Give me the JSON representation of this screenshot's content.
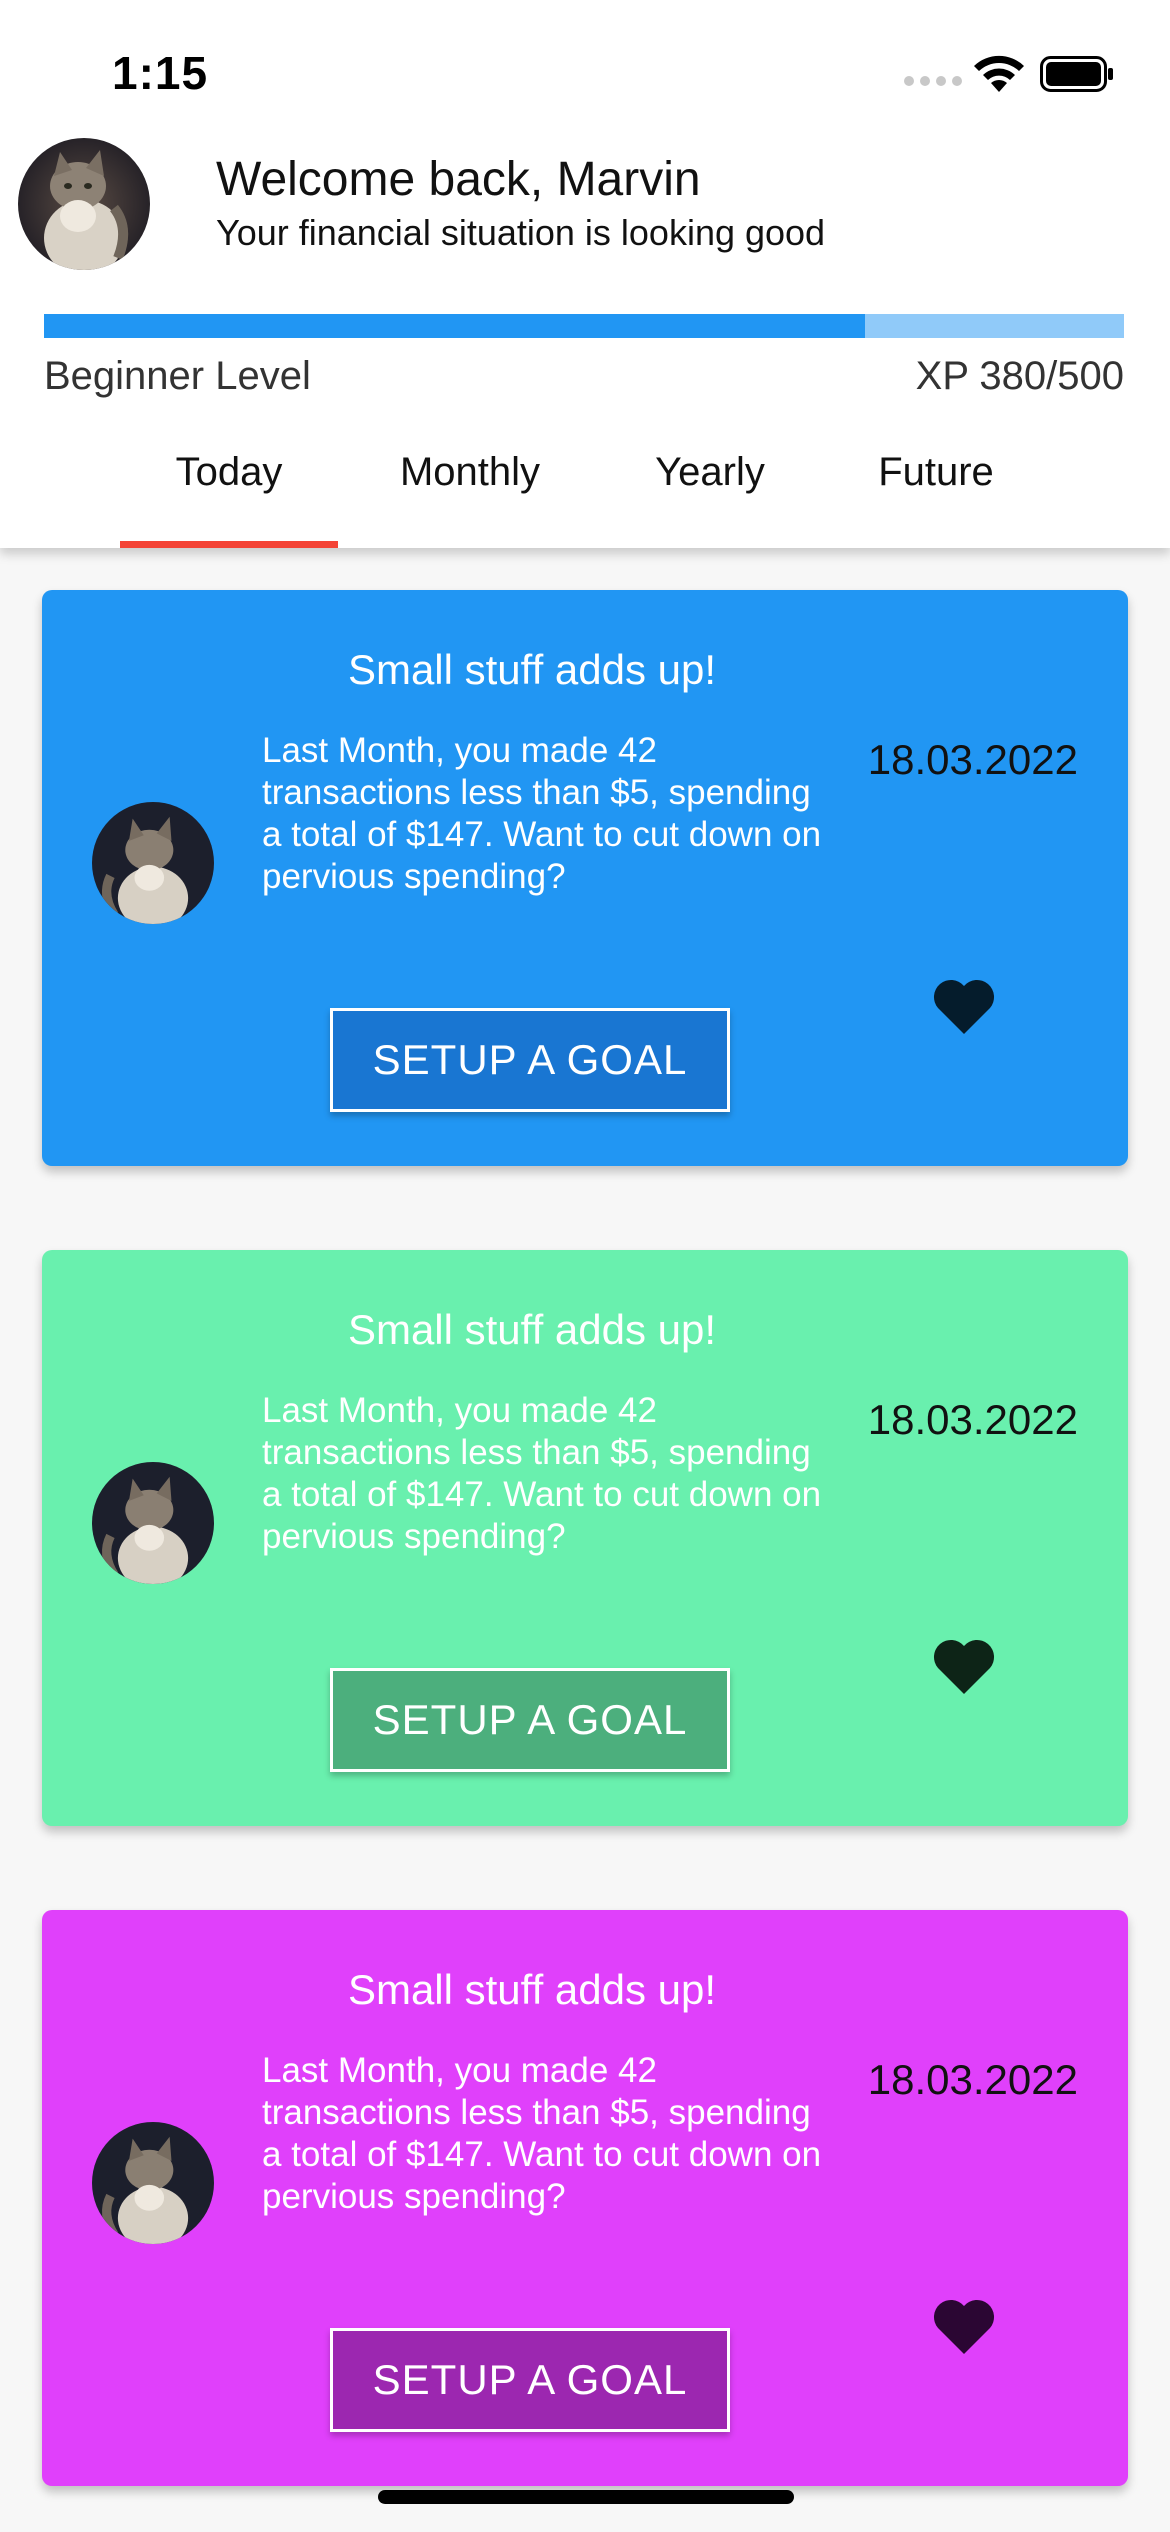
{
  "status_bar": {
    "time": "1:15"
  },
  "header": {
    "welcome_title": "Welcome back, Marvin",
    "welcome_subtitle": "Your financial situation is looking good",
    "avatar_icon": "cat-avatar-icon"
  },
  "progress": {
    "level_label": "Beginner Level",
    "xp_label": "XP 380/500",
    "xp_current": 380,
    "xp_max": 500,
    "fill_color": "#2196f3",
    "track_color": "#90caf9"
  },
  "tabs": [
    {
      "label": "Today",
      "selected": true
    },
    {
      "label": "Monthly",
      "selected": false
    },
    {
      "label": "Yearly",
      "selected": false
    },
    {
      "label": "Future",
      "selected": false
    }
  ],
  "tab_indicator_color": "#f44336",
  "cards": [
    {
      "title": "Small stuff adds up!",
      "body": "Last Month, you made 42 transactions less than $5, spending a total of $147. Want to cut down on pervious spending?",
      "date": "18.03.2022",
      "button_label": "SETUP A GOAL",
      "background": "#2196f3",
      "button_color": "#1976d2",
      "heart_color": "#051c2c"
    },
    {
      "title": "Small stuff adds up!",
      "body": "Last Month, you made 42 transactions less than $5, spending a total of $147. Want to cut down on pervious spending?",
      "date": "18.03.2022",
      "button_label": "SETUP A GOAL",
      "background": "#69f0ae",
      "button_color": "#4caf7d",
      "heart_color": "#0d2417"
    },
    {
      "title": "Small stuff adds up!",
      "body": "Last Month, you made 42 transactions less than $5, spending a total of $147. Want to cut down on pervious spending?",
      "date": "18.03.2022",
      "button_label": "SETUP A GOAL",
      "background": "#e040fb",
      "button_color": "#9c27b0",
      "heart_color": "#2b0633"
    }
  ]
}
